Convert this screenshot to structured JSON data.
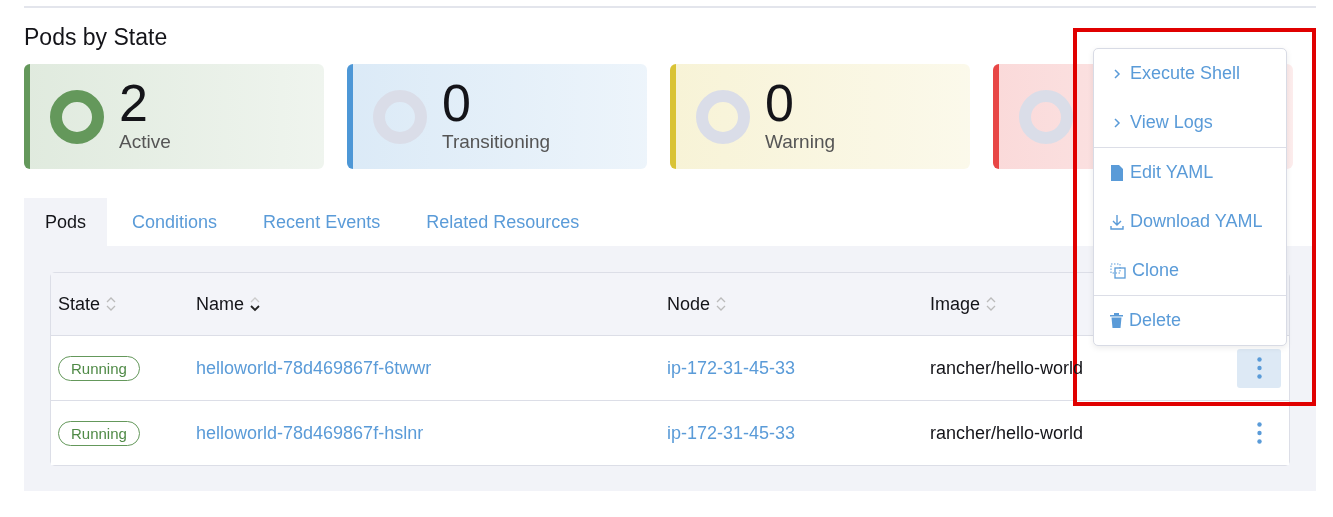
{
  "section_title": "Pods by State",
  "state_cards": [
    {
      "count": "2",
      "label": "Active",
      "color": "#64985b",
      "kind": "filled"
    },
    {
      "count": "0",
      "label": "Transitioning",
      "color": "#4d97d6",
      "kind": "empty"
    },
    {
      "count": "0",
      "label": "Warning",
      "color": "#d9c336",
      "kind": "empty"
    },
    {
      "color": "#e84645",
      "kind": "empty"
    }
  ],
  "tabs": [
    {
      "label": "Pods",
      "selected": true
    },
    {
      "label": "Conditions",
      "selected": false
    },
    {
      "label": "Recent Events",
      "selected": false
    },
    {
      "label": "Related Resources",
      "selected": false
    }
  ],
  "table": {
    "columns": [
      {
        "label": "State",
        "sorted": false
      },
      {
        "label": "Name",
        "sorted": true
      },
      {
        "label": "Node",
        "sorted": false
      },
      {
        "label": "Image",
        "sorted": false
      }
    ],
    "rows": [
      {
        "state": "Running",
        "name": "helloworld-78d469867f-6twwr",
        "node": "ip-172-31-45-33",
        "image": "rancher/hello-world",
        "actions_active": true
      },
      {
        "state": "Running",
        "name": "helloworld-78d469867f-hslnr",
        "node": "ip-172-31-45-33",
        "image": "rancher/hello-world",
        "actions_active": false
      }
    ]
  },
  "action_menu": {
    "groups": [
      [
        {
          "label": "Execute Shell",
          "kind": "chevron"
        },
        {
          "label": "View Logs",
          "kind": "chevron"
        }
      ],
      [
        {
          "label": "Edit YAML",
          "kind": "file"
        },
        {
          "label": "Download YAML",
          "kind": "download"
        },
        {
          "label": "Clone",
          "kind": "clone"
        }
      ],
      [
        {
          "label": "Delete",
          "kind": "trash"
        }
      ]
    ]
  }
}
